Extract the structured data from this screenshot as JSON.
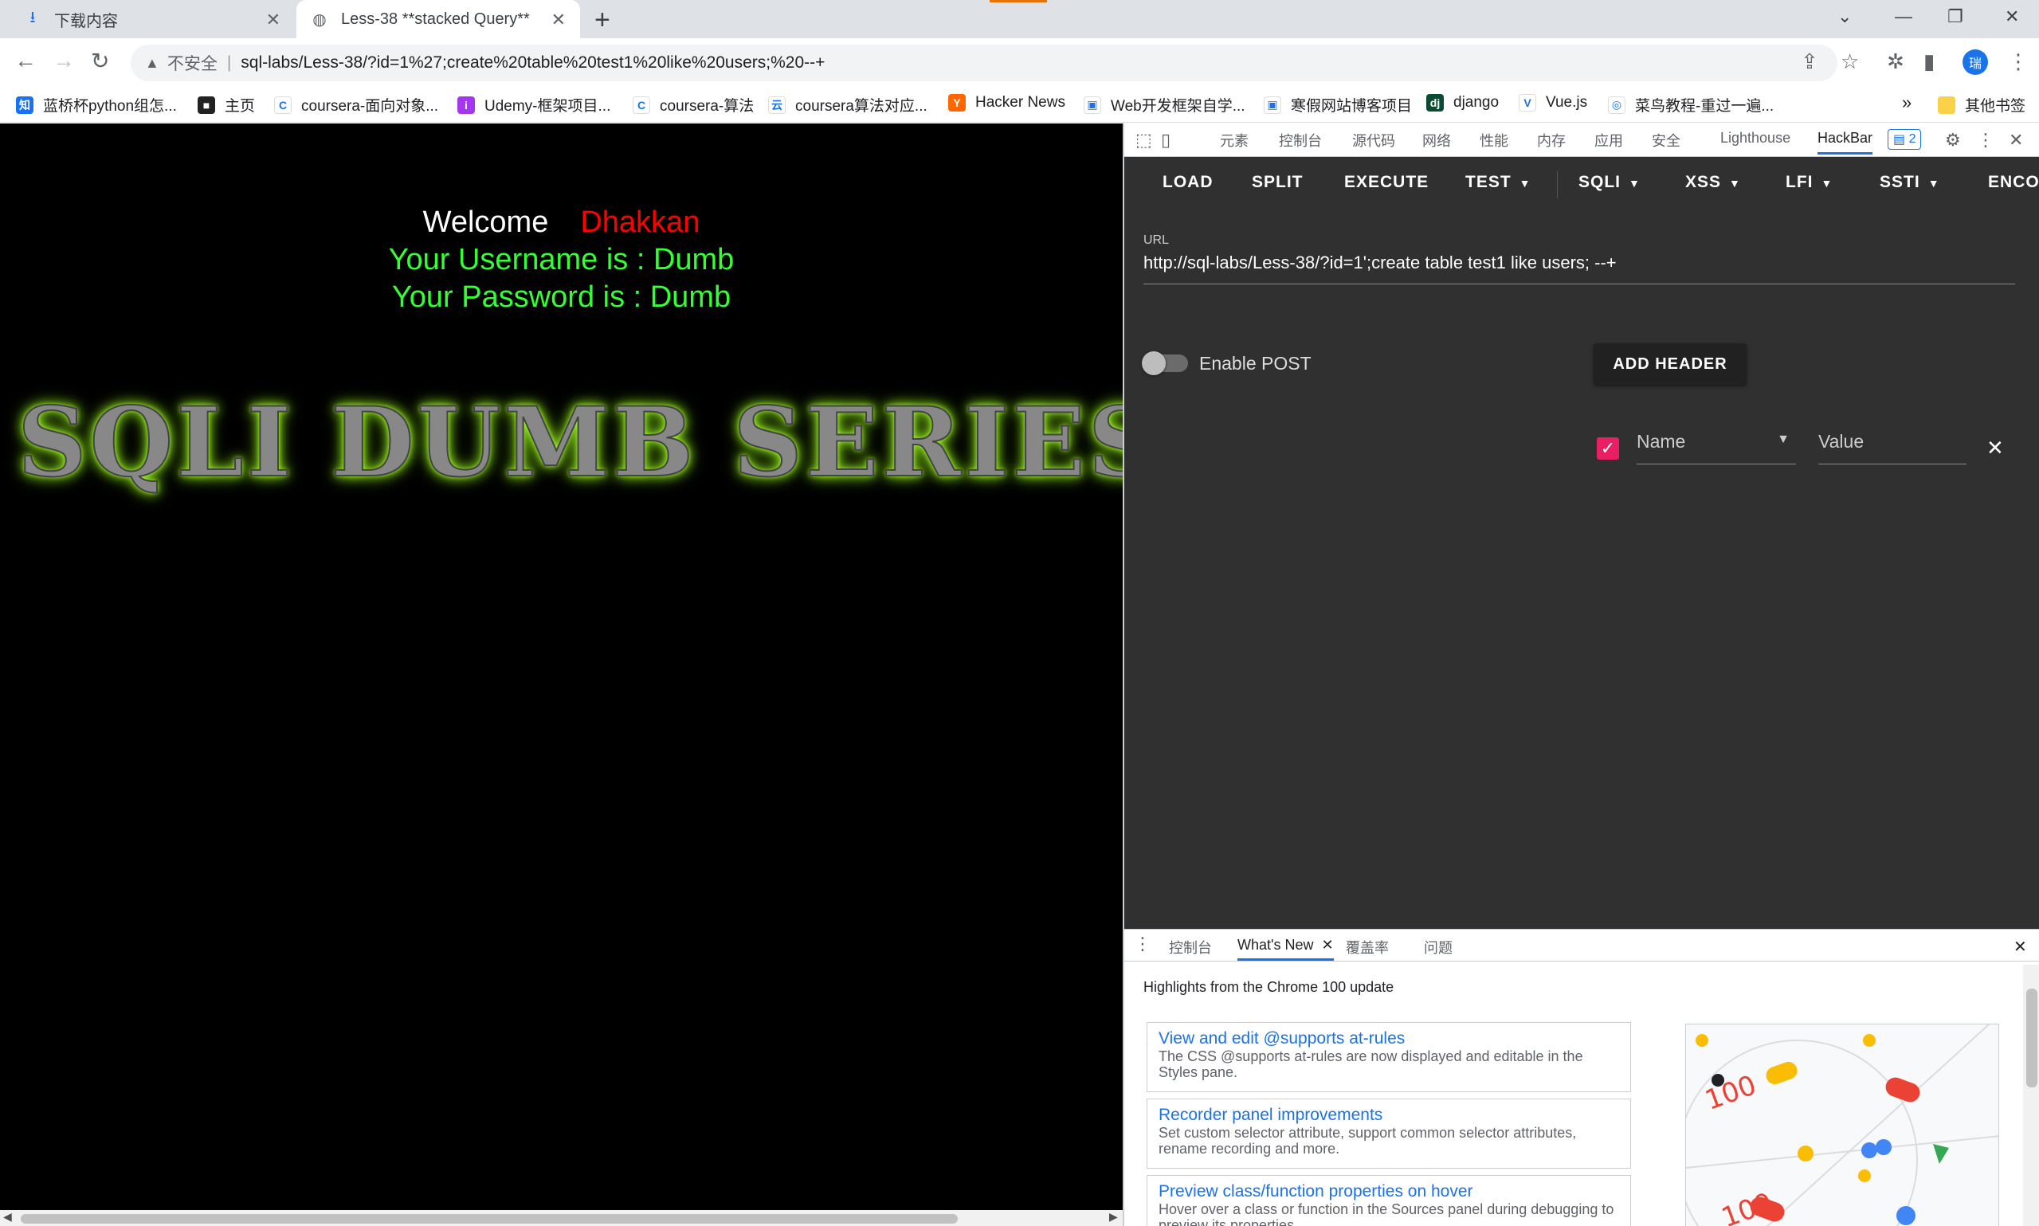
{
  "tabs": [
    {
      "title": "下载内容",
      "icon": "download-icon"
    },
    {
      "title": "Less-38 **stacked Query**",
      "icon": "globe-icon"
    }
  ],
  "address": {
    "security_label": "不安全",
    "separator": "|",
    "url": "sql-labs/Less-38/?id=1%27;create%20table%20test1%20like%20users;%20--+"
  },
  "profile_initial": "瑞",
  "bookmarks": [
    {
      "label": "蓝桥杯python组怎...",
      "icon": "zhihu-icon",
      "color": "#1772f6",
      "glyph": "知"
    },
    {
      "label": "主页",
      "icon": "home-site-icon",
      "color": "#222222",
      "glyph": "■"
    },
    {
      "label": "coursera-面向对象...",
      "icon": "coursera-icon",
      "color": "#ffffff",
      "glyph": "C"
    },
    {
      "label": "Udemy-框架项目...",
      "icon": "udemy-icon",
      "color": "#a435f0",
      "glyph": "i"
    },
    {
      "label": "coursera-算法",
      "icon": "coursera-icon",
      "color": "#ffffff",
      "glyph": "C"
    },
    {
      "label": "coursera算法对应...",
      "icon": "green-site-icon",
      "color": "#ffffff",
      "glyph": "云"
    },
    {
      "label": "Hacker News",
      "icon": "hackernews-icon",
      "color": "#ff6600",
      "glyph": "Y"
    },
    {
      "label": "Web开发框架自学...",
      "icon": "bilibili-icon",
      "color": "#ffffff",
      "glyph": "▣"
    },
    {
      "label": "寒假网站博客项目",
      "icon": "bilibili-icon",
      "color": "#ffffff",
      "glyph": "▣"
    },
    {
      "label": "django",
      "icon": "django-icon",
      "color": "#0c4b33",
      "glyph": "dj"
    },
    {
      "label": "Vue.js",
      "icon": "vue-icon",
      "color": "#ffffff",
      "glyph": "V"
    },
    {
      "label": "菜鸟教程-重过一遍...",
      "icon": "runoob-icon",
      "color": "#ffffff",
      "glyph": "◎"
    }
  ],
  "bookmarks_overflow": "»",
  "other_bookmarks": "其他书签",
  "page": {
    "welcome": "Welcome",
    "user": "Dhakkan",
    "username_line": "Your Username is : Dumb",
    "password_line": "Your Password is : Dumb",
    "banner": "SQLI DUMB SERIES-"
  },
  "devtools": {
    "tabs": [
      "元素",
      "控制台",
      "源代码",
      "网络",
      "性能",
      "内存",
      "应用",
      "安全",
      "Lighthouse",
      "HackBar"
    ],
    "active_tab": "HackBar",
    "issues_count": "2"
  },
  "hackbar": {
    "buttons": [
      {
        "label": "LOAD",
        "dropdown": false
      },
      {
        "label": "SPLIT",
        "dropdown": false
      },
      {
        "label": "EXECUTE",
        "dropdown": false
      },
      {
        "label": "TEST",
        "dropdown": true
      },
      {
        "label": "SQLI",
        "dropdown": true
      },
      {
        "label": "XSS",
        "dropdown": true
      },
      {
        "label": "LFI",
        "dropdown": true
      },
      {
        "label": "SSTI",
        "dropdown": true
      },
      {
        "label": "ENCO",
        "dropdown": false
      }
    ],
    "url_label": "URL",
    "url_value": "http://sql-labs/Less-38/?id=1';create table test1 like users; --+",
    "enable_post_label": "Enable POST",
    "enable_post": false,
    "add_header_label": "ADD HEADER",
    "header_name_placeholder": "Name",
    "header_value_placeholder": "Value",
    "header_enabled": true
  },
  "drawer": {
    "tabs": [
      "控制台",
      "What's New",
      "覆盖率",
      "问题"
    ],
    "active_tab": "What's New",
    "headline": "Highlights from the Chrome 100 update",
    "cards": [
      {
        "title": "View and edit @supports at-rules",
        "desc": "The CSS @supports at-rules are now displayed and editable in the Styles pane."
      },
      {
        "title": "Recorder panel improvements",
        "desc": "Set custom selector attribute, support common selector attributes, rename recording and more."
      },
      {
        "title": "Preview class/function properties on hover",
        "desc": "Hover over a class or function in the Sources panel during debugging to preview its properties."
      }
    ]
  },
  "colors": {
    "accent": "#1a73e8",
    "hackbar_bg": "#303030",
    "welcome_name": "#ff0000",
    "green_text": "#33ff33",
    "checkbox": "#e91e63"
  }
}
